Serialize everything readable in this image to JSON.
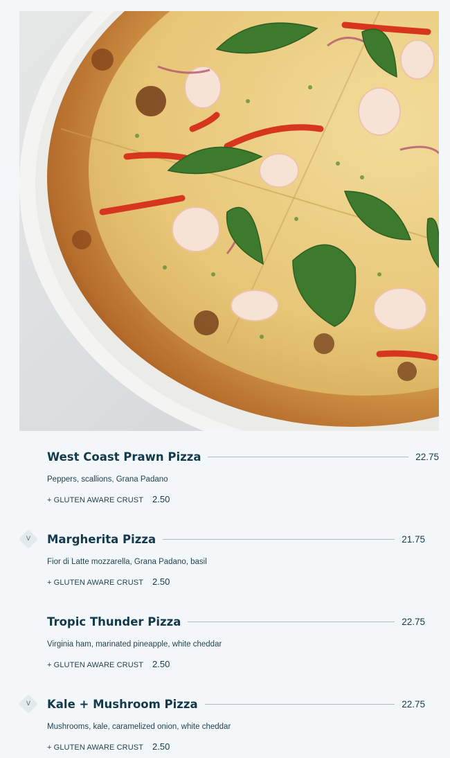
{
  "hero": {
    "alt": "West Coast Prawn Pizza with basil, prawns and red peppers"
  },
  "menu": {
    "items": [
      {
        "name": "West Coast Prawn Pizza",
        "price": "22.75",
        "description": "Peppers, scallions, Grana Padano",
        "addon_label": "+ GLUTEN AWARE CRUST",
        "addon_price": "2.50",
        "vegetarian": false
      },
      {
        "name": "Margherita Pizza",
        "price": "21.75",
        "description": "Fior di Latte mozzarella, Grana Padano, basil",
        "addon_label": "+ GLUTEN AWARE CRUST",
        "addon_price": "2.50",
        "vegetarian": true,
        "badge": "V"
      },
      {
        "name": "Tropic Thunder Pizza",
        "price": "22.75",
        "description": "Virginia ham, marinated pineapple, white cheddar",
        "addon_label": "+ GLUTEN AWARE CRUST",
        "addon_price": "2.50",
        "vegetarian": false
      },
      {
        "name": "Kale + Mushroom Pizza",
        "price": "22.75",
        "description": "Mushrooms, kale, caramelized onion, white cheddar",
        "addon_label": "+ GLUTEN AWARE CRUST",
        "addon_price": "2.50",
        "vegetarian": true,
        "badge": "V"
      }
    ]
  },
  "colors": {
    "background": "#f3f7f9",
    "text_dark": "#123a4a",
    "leader_line": "#aebcc2",
    "badge_bg": "#e3eaed"
  }
}
